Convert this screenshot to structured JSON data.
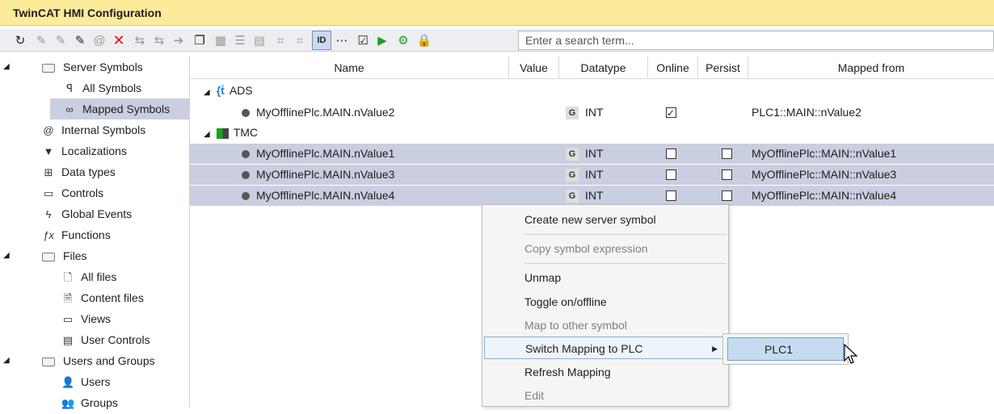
{
  "window": {
    "title": "TwinCAT HMI Configuration"
  },
  "toolbar": {
    "icons": [
      "refresh-icon",
      "add-symbol-icon",
      "add-child-icon",
      "edit-icon",
      "at-icon",
      "delete-icon",
      "map-icon",
      "unmap-icon",
      "arrow-icon",
      "copy-icon",
      "filter-icon",
      "list-icon",
      "table-icon",
      "tag-icon",
      "tag2-icon",
      "id-icon",
      "more-icon",
      "checkbox-icon",
      "play-icon",
      "deploy-icon",
      "lock-icon"
    ],
    "search_placeholder": "Enter a search term..."
  },
  "tree": {
    "items": [
      {
        "label": "Server Symbols",
        "icon": "folder-icon",
        "level": 0,
        "expanded": true
      },
      {
        "label": "All Symbols",
        "icon": "symbols-icon",
        "level": 1
      },
      {
        "label": "Mapped Symbols",
        "icon": "link-icon",
        "level": 1,
        "selected": true
      },
      {
        "label": "Internal Symbols",
        "icon": "at-icon",
        "level": 0
      },
      {
        "label": "Localizations",
        "icon": "flag-icon",
        "level": 0
      },
      {
        "label": "Data types",
        "icon": "datatype-icon",
        "level": 0
      },
      {
        "label": "Controls",
        "icon": "control-icon",
        "level": 0
      },
      {
        "label": "Global Events",
        "icon": "lightning-icon",
        "level": 0
      },
      {
        "label": "Functions",
        "icon": "function-icon",
        "level": 0
      },
      {
        "label": "Files",
        "icon": "folder-icon",
        "level": 0,
        "expanded": true
      },
      {
        "label": "All files",
        "icon": "file-icon",
        "level": 1
      },
      {
        "label": "Content files",
        "icon": "content-file-icon",
        "level": 1
      },
      {
        "label": "Views",
        "icon": "view-icon",
        "level": 1
      },
      {
        "label": "User Controls",
        "icon": "user-control-icon",
        "level": 1
      },
      {
        "label": "Users and Groups",
        "icon": "folder-icon",
        "level": 0,
        "expanded": true
      },
      {
        "label": "Users",
        "icon": "user-icon",
        "level": 1
      },
      {
        "label": "Groups",
        "icon": "group-icon",
        "level": 1
      }
    ]
  },
  "grid": {
    "columns": [
      "Name",
      "Value",
      "Datatype",
      "Online",
      "Persist",
      "Mapped from"
    ],
    "groups": [
      {
        "label": "ADS",
        "rows": [
          {
            "name": "MyOfflinePlc.MAIN.nValue2",
            "value": "",
            "datatype_badge": "G",
            "datatype": "INT",
            "online": true,
            "persist": null,
            "mapped_from": "PLC1::MAIN::nValue2",
            "selected": false
          }
        ]
      },
      {
        "label": "TMC",
        "rows": [
          {
            "name": "MyOfflinePlc.MAIN.nValue1",
            "value": "",
            "datatype_badge": "G",
            "datatype": "INT",
            "online": false,
            "persist": false,
            "mapped_from": "MyOfflinePlc::MAIN::nValue1",
            "selected": true
          },
          {
            "name": "MyOfflinePlc.MAIN.nValue3",
            "value": "",
            "datatype_badge": "G",
            "datatype": "INT",
            "online": false,
            "persist": false,
            "mapped_from": "MyOfflinePlc::MAIN::nValue3",
            "selected": true
          },
          {
            "name": "MyOfflinePlc.MAIN.nValue4",
            "value": "",
            "datatype_badge": "G",
            "datatype": "INT",
            "online": false,
            "persist": false,
            "mapped_from": "MyOfflinePlc::MAIN::nValue4",
            "selected": true
          }
        ]
      }
    ]
  },
  "context_menu": {
    "items": [
      {
        "label": "Create new server symbol",
        "disabled": false
      },
      {
        "label": "Copy symbol expression",
        "disabled": true
      },
      {
        "label": "Unmap",
        "disabled": false
      },
      {
        "label": "Toggle on/offline",
        "disabled": false
      },
      {
        "label": "Map to other symbol",
        "disabled": true
      },
      {
        "label": "Switch Mapping to PLC",
        "disabled": false,
        "highlighted": true,
        "has_submenu": true
      },
      {
        "label": "Refresh Mapping",
        "disabled": false
      },
      {
        "label": "Edit",
        "disabled": true
      }
    ],
    "submenu": {
      "items": [
        {
          "label": "PLC1",
          "highlighted": true
        }
      ]
    }
  }
}
